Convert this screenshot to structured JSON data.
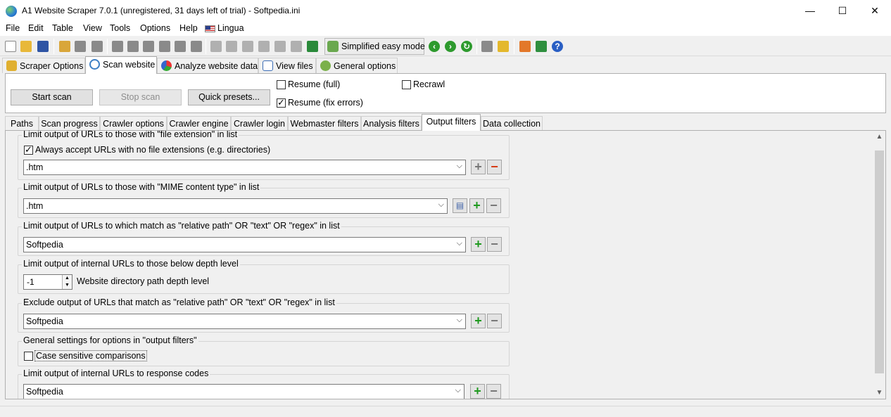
{
  "window": {
    "title": "A1 Website Scraper 7.0.1 (unregistered, 31 days left of trial) - Softpedia.ini",
    "minimize": "—",
    "maximize": "☐",
    "close": "✕"
  },
  "menu": {
    "file": "File",
    "edit": "Edit",
    "table": "Table",
    "view": "View",
    "tools": "Tools",
    "options": "Options",
    "help": "Help",
    "lingua": "Lingua"
  },
  "toolbar": {
    "simplified_mode": "Simplified easy mode"
  },
  "top_tabs": {
    "scraper_options": "Scraper Options",
    "scan_website": "Scan website",
    "analyze_website_data": "Analyze website data",
    "view_files": "View files",
    "general_options": "General options"
  },
  "scan_panel": {
    "start_scan": "Start scan",
    "stop_scan": "Stop scan",
    "quick_presets": "Quick presets...",
    "resume_full": "Resume (full)",
    "resume_fix_errors": "Resume (fix errors)",
    "recrawl": "Recrawl",
    "resume_full_checked": false,
    "resume_fix_errors_checked": true,
    "recrawl_checked": false
  },
  "inner_tabs": {
    "paths": "Paths",
    "scan_progress": "Scan progress",
    "crawler_options": "Crawler options",
    "crawler_engine": "Crawler engine",
    "crawler_login": "Crawler login",
    "webmaster_filters": "Webmaster filters",
    "analysis_filters": "Analysis filters",
    "output_filters": "Output filters",
    "data_collection": "Data collection"
  },
  "output_filters": {
    "file_extension": {
      "title": "Limit output of URLs to those with \"file extension\" in list",
      "accept_no_ext_label": "Always accept URLs with no file extensions (e.g. directories)",
      "accept_no_ext_checked": true,
      "value": ".htm"
    },
    "mime": {
      "title": "Limit output of URLs to those with \"MIME content type\" in list",
      "value": ".htm"
    },
    "relative_path": {
      "title": "Limit output of URLs to which match as \"relative path\" OR \"text\" OR \"regex\" in list",
      "value": "Softpedia"
    },
    "depth": {
      "title": "Limit output of internal URLs to those below depth level",
      "value": "-1",
      "label": "Website directory path depth level"
    },
    "exclude": {
      "title": "Exclude output of URLs that match as \"relative path\" OR \"text\" OR \"regex\" in list",
      "value": "Softpedia"
    },
    "general": {
      "title": "General settings for options in \"output filters\"",
      "case_sensitive_label": "Case sensitive comparisons",
      "case_sensitive_checked": false
    },
    "response_codes": {
      "title": "Limit output of internal URLs to response codes",
      "value": "Softpedia"
    }
  },
  "glyphs": {
    "plus": "+",
    "minus": "−",
    "combo_arrow": "⌵",
    "spin_up": "▲",
    "spin_down": "▼",
    "scroll_up": "▲",
    "scroll_down": "▼",
    "book": "▤"
  },
  "colors": {
    "accent_green": "#1f9a1f",
    "remove_red": "#d63a12",
    "panel_bg": "#f0f0f0"
  }
}
